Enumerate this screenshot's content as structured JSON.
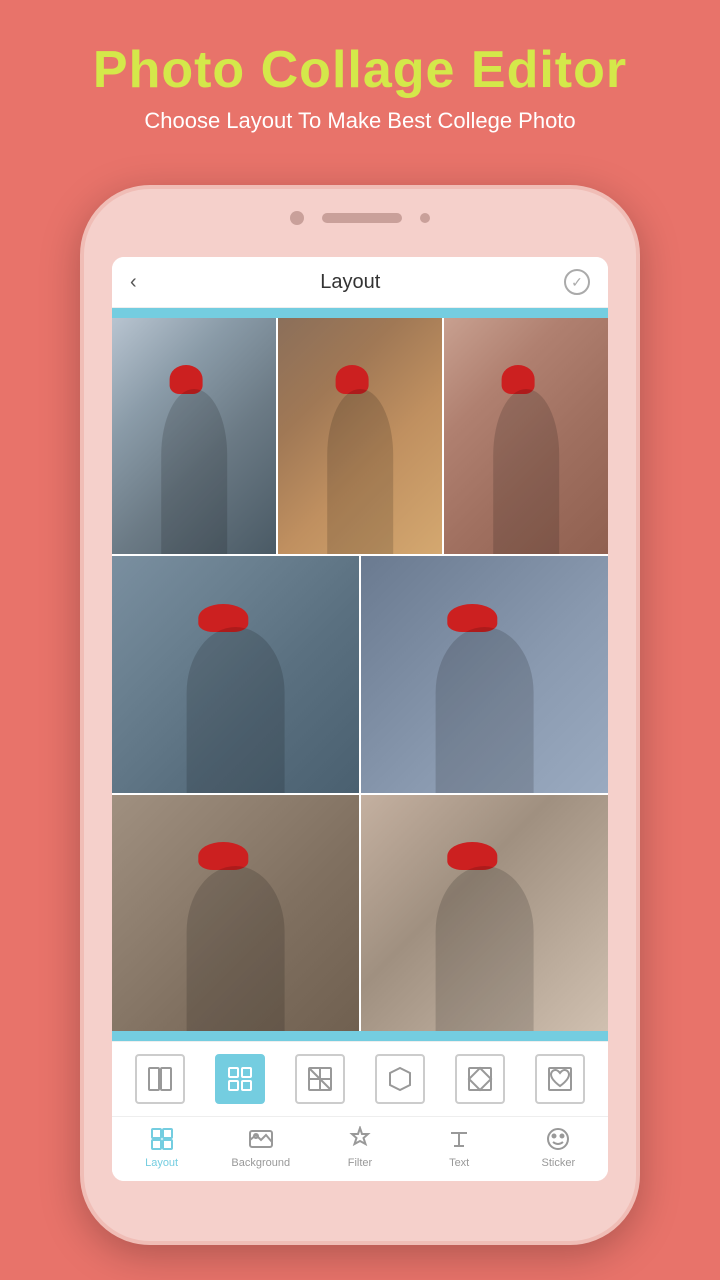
{
  "page": {
    "bg_color": "#e8736a"
  },
  "header": {
    "title": "Photo Collage Editor",
    "subtitle": "Choose Layout To Make Best College Photo",
    "title_color": "#d4e84a",
    "subtitle_color": "#ffffff"
  },
  "app": {
    "screen_title": "Layout",
    "back_icon": "‹",
    "check_icon": "✓"
  },
  "layout_options": [
    {
      "id": "two-col",
      "label": "two-column",
      "active": false
    },
    {
      "id": "four-grid",
      "label": "four-grid",
      "active": true
    },
    {
      "id": "diagonal",
      "label": "diagonal",
      "active": false
    },
    {
      "id": "hexagon",
      "label": "hexagon",
      "active": false
    },
    {
      "id": "diamond",
      "label": "diamond",
      "active": false
    },
    {
      "id": "heart",
      "label": "heart",
      "active": false
    }
  ],
  "bottom_nav": [
    {
      "id": "layout",
      "label": "Layout",
      "active": true
    },
    {
      "id": "background",
      "label": "Background",
      "active": false
    },
    {
      "id": "filter",
      "label": "Filter",
      "active": false
    },
    {
      "id": "text",
      "label": "Text",
      "active": false
    },
    {
      "id": "sticker",
      "label": "Sticker",
      "active": false
    }
  ]
}
